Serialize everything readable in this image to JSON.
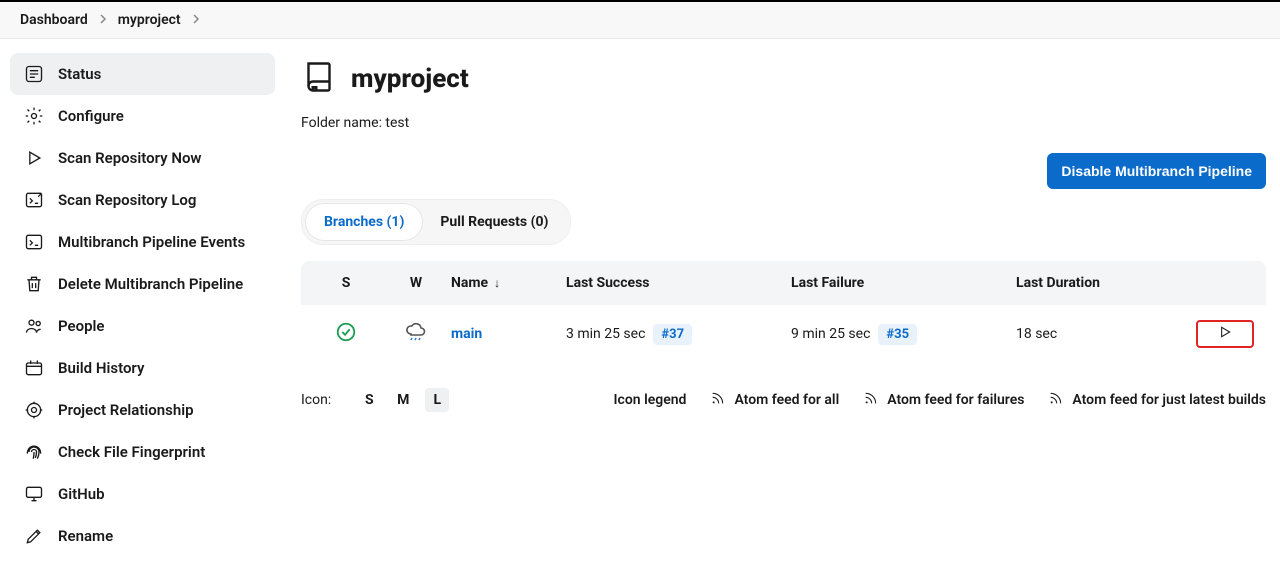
{
  "breadcrumb": {
    "items": [
      "Dashboard",
      "myproject"
    ]
  },
  "sidebar": {
    "items": [
      {
        "label": "Status",
        "icon": "list-icon",
        "active": true
      },
      {
        "label": "Configure",
        "icon": "gear-icon"
      },
      {
        "label": "Scan Repository Now",
        "icon": "play-icon"
      },
      {
        "label": "Scan Repository Log",
        "icon": "terminal-out-icon"
      },
      {
        "label": "Multibranch Pipeline Events",
        "icon": "terminal-in-icon"
      },
      {
        "label": "Delete Multibranch Pipeline",
        "icon": "trash-icon"
      },
      {
        "label": "People",
        "icon": "people-icon"
      },
      {
        "label": "Build History",
        "icon": "history-icon"
      },
      {
        "label": "Project Relationship",
        "icon": "target-icon"
      },
      {
        "label": "Check File Fingerprint",
        "icon": "fingerprint-icon"
      },
      {
        "label": "GitHub",
        "icon": "monitor-icon"
      },
      {
        "label": "Rename",
        "icon": "pencil-icon"
      }
    ]
  },
  "page": {
    "title": "myproject",
    "folder_label": "Folder name: test",
    "disable_btn": "Disable Multibranch Pipeline"
  },
  "tabs": {
    "branches": "Branches (1)",
    "pull_requests": "Pull Requests (0)"
  },
  "table": {
    "headers": {
      "status": "S",
      "weather": "W",
      "name": "Name",
      "name_sort": "↓",
      "last_success": "Last Success",
      "last_failure": "Last Failure",
      "last_duration": "Last Duration"
    },
    "row": {
      "status_icon": "success",
      "weather_icon": "rainy",
      "name": "main",
      "last_success_time": "3 min 25 sec",
      "last_success_build": "#37",
      "last_failure_time": "9 min 25 sec",
      "last_failure_build": "#35",
      "last_duration": "18 sec"
    }
  },
  "footer": {
    "icon_label": "Icon:",
    "sizes": [
      "S",
      "M",
      "L"
    ],
    "active_size": "L",
    "legend": "Icon legend",
    "feed_all": "Atom feed for all",
    "feed_failures": "Atom feed for failures",
    "feed_latest": "Atom feed for just latest builds"
  }
}
